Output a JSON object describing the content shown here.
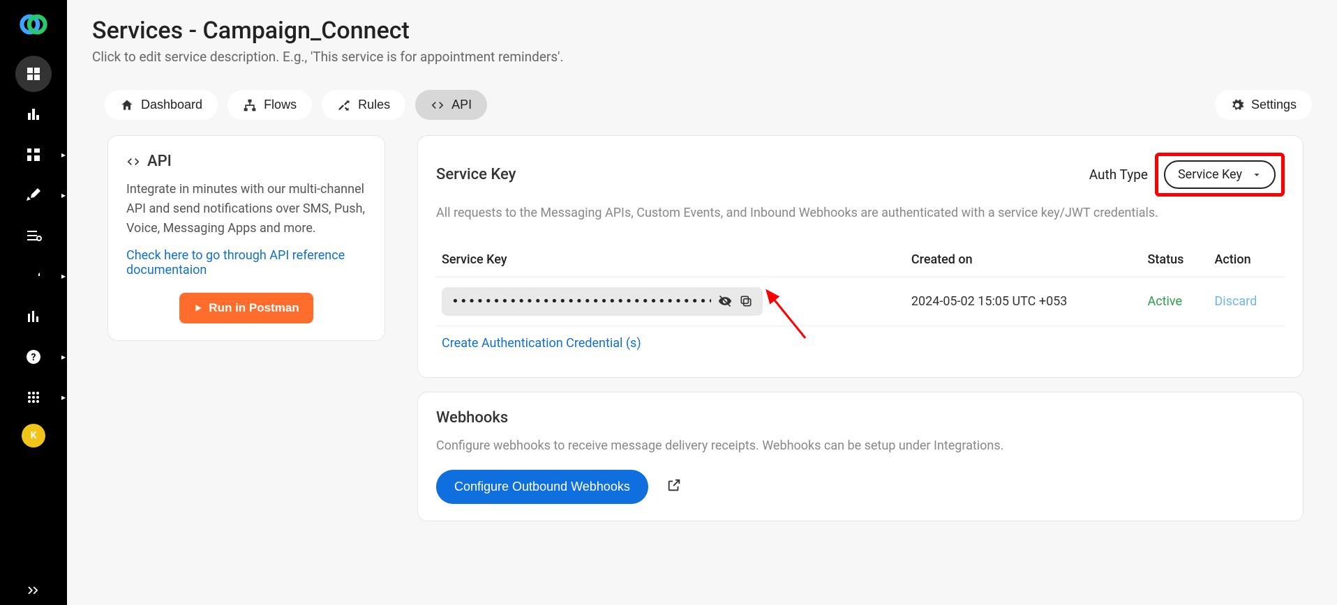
{
  "sidebar": {
    "avatar_letter": "K"
  },
  "header": {
    "title": "Services - Campaign_Connect",
    "subtitle": "Click to edit service description. E.g., 'This service is for appointment reminders'."
  },
  "tabs": {
    "dashboard": "Dashboard",
    "flows": "Flows",
    "rules": "Rules",
    "api": "API",
    "settings": "Settings"
  },
  "api_card": {
    "title": "API",
    "desc": "Integrate in minutes with our multi-channel API and send notifications over SMS, Push, Voice, Messaging Apps and more.",
    "doc_link": "Check here to go through API reference documentaion",
    "postman_btn": "Run in Postman"
  },
  "service_key_card": {
    "title": "Service Key",
    "auth_label": "Auth Type",
    "auth_value": "Service Key",
    "desc": "All requests to the Messaging APIs, Custom Events, and Inbound Webhooks are authenticated with a service key/JWT credentials.",
    "table": {
      "headers": {
        "key": "Service Key",
        "created": "Created on",
        "status": "Status",
        "action": "Action"
      },
      "row": {
        "masked_key": "••••••••••••••••••••••••••••••••••",
        "created_on": "2024-05-02 15:05 UTC +053",
        "status": "Active",
        "action": "Discard"
      }
    },
    "create_link": "Create Authentication Credential (s)"
  },
  "webhooks_card": {
    "title": "Webhooks",
    "desc": "Configure webhooks to receive message delivery receipts. Webhooks can be setup under Integrations.",
    "configure_btn": "Configure Outbound Webhooks"
  }
}
